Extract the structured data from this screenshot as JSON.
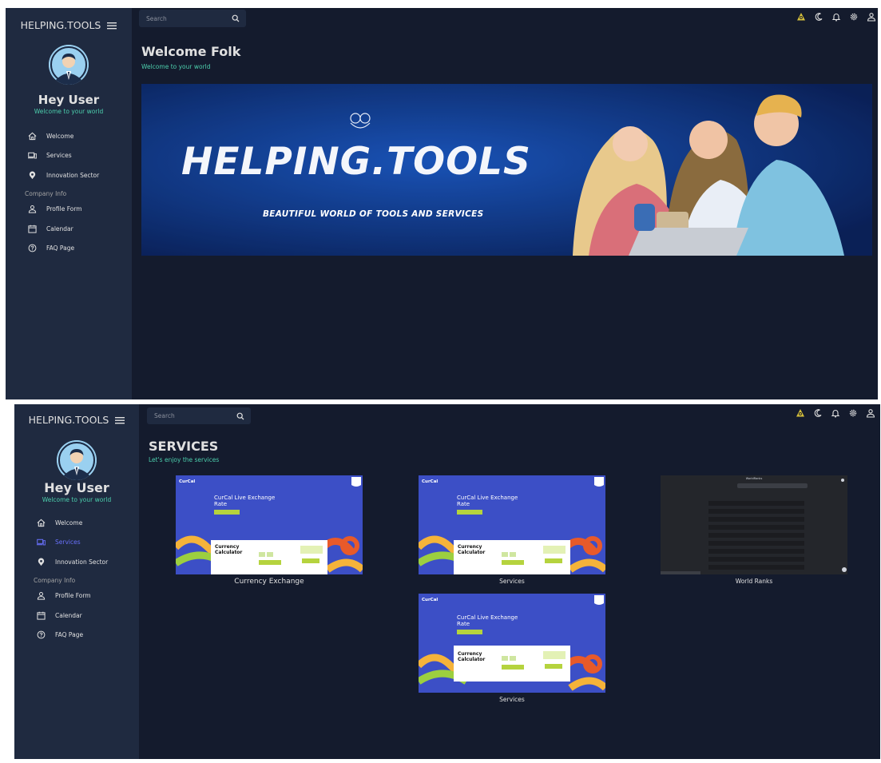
{
  "brand": "HELPING.TOOLS",
  "search": {
    "placeholder": "Search"
  },
  "user": {
    "name": "Hey User",
    "subtitle": "Welcome to your world"
  },
  "nav": {
    "items": [
      {
        "label": "Welcome",
        "icon": "home-icon"
      },
      {
        "label": "Services",
        "icon": "devices-icon"
      },
      {
        "label": "Innovation Sector",
        "icon": "map-pin-icon"
      }
    ],
    "section": "Company Info",
    "company_items": [
      {
        "label": "Profile Form",
        "icon": "person-icon"
      },
      {
        "label": "Calendar",
        "icon": "calendar-icon"
      },
      {
        "label": "FAQ Page",
        "icon": "help-icon"
      }
    ]
  },
  "topbar_icons": [
    "globe-pin-icon",
    "moon-icon",
    "bell-icon",
    "settings-icon",
    "profile-icon"
  ],
  "screen1": {
    "title": "Welcome Folk",
    "subtitle": "Welcome to your world",
    "banner": {
      "title": "HELPING.TOOLS",
      "tagline": "BEAUTIFUL WORLD OF TOOLS AND SERVICES"
    },
    "active_nav": "Welcome"
  },
  "screen2": {
    "title": "SERVICES",
    "subtitle": "Let's enjoy the services",
    "active_nav": "Services",
    "cards": [
      {
        "label": "Currency Exchange",
        "thumb": {
          "brand": "CurCal",
          "headline": "CurCal Live Exchange Rate",
          "calc_title": "Currency Calculator"
        }
      },
      {
        "label": "Services",
        "thumb": {
          "brand": "CurCal",
          "headline": "CurCal Live Exchange Rate",
          "calc_title": "Currency Calculator"
        }
      },
      {
        "label": "World Ranks",
        "thumb": {
          "brand": "WorldRanks"
        }
      },
      {
        "label": "Services",
        "thumb": {
          "brand": "CurCal",
          "headline": "CurCal Live Exchange Rate",
          "calc_title": "Currency Calculator"
        }
      }
    ]
  },
  "colors": {
    "background": "#141b2d",
    "sidebar": "#1f2a40",
    "accent_green": "#4cceac",
    "active_nav": "#6870fa",
    "curcal_blue": "#3c4fc6",
    "curcal_button": "#b5d33e",
    "banner_blue": "#123a86"
  }
}
